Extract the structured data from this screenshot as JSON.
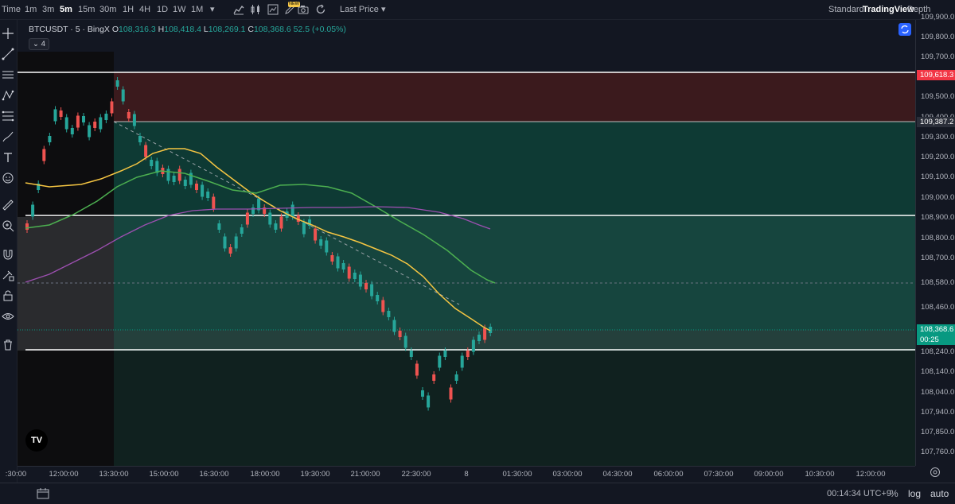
{
  "toolbar": {
    "time_label": "Time",
    "intervals": [
      "1m",
      "3m",
      "5m",
      "15m",
      "30m",
      "1H",
      "4H",
      "1D",
      "1W",
      "1M"
    ],
    "active_interval": "5m",
    "price_source": "Last Price",
    "new_badge": "NEW",
    "views": [
      "Standard",
      "TradingView",
      "Depth"
    ],
    "active_view": "TradingView"
  },
  "legend": {
    "symbol": "BTCUSDT · 5 · BingX",
    "o_label": "O",
    "o": "108,316.3",
    "h_label": "H",
    "h": "108,418.4",
    "l_label": "L",
    "l": "108,269.1",
    "c_label": "C",
    "c": "108,368.6",
    "change": "52.5 (+0.05%)",
    "indicator_count": "4"
  },
  "price_axis": {
    "ticks": [
      "109,900.0",
      "109,800.0",
      "109,700.0",
      "109,600.0",
      "109,500.0",
      "109,400.0",
      "109,300.0",
      "109,200.0",
      "109,100.0",
      "109,000.0",
      "108,900.0",
      "108,800.0",
      "108,700.0",
      "108,580.0",
      "108,460.0",
      "108,340.0",
      "108,240.0",
      "108,140.0",
      "108,040.0",
      "107,940.0",
      "107,850.0",
      "107,760.0"
    ],
    "stop_label": "109,618.3",
    "entry_label": "109,387.2",
    "last_price": "108,368.6",
    "countdown": "00:25",
    "colors": {
      "stop": "#f23645",
      "entry": "#2a2e39",
      "last": "#089981"
    }
  },
  "time_axis": {
    "ticks": [
      ":30:00",
      "12:00:00",
      "13:30:00",
      "15:00:00",
      "16:30:00",
      "18:00:00",
      "19:30:00",
      "21:00:00",
      "22:30:00",
      "8",
      "01:30:00",
      "03:00:00",
      "04:30:00",
      "06:00:00",
      "07:30:00",
      "09:00:00",
      "10:30:00",
      "12:00:00"
    ]
  },
  "status": {
    "clock": "00:14:34 UTC+9",
    "percent": "%",
    "log": "log",
    "auto": "auto"
  },
  "brand": {
    "logo_text": "TV"
  }
}
